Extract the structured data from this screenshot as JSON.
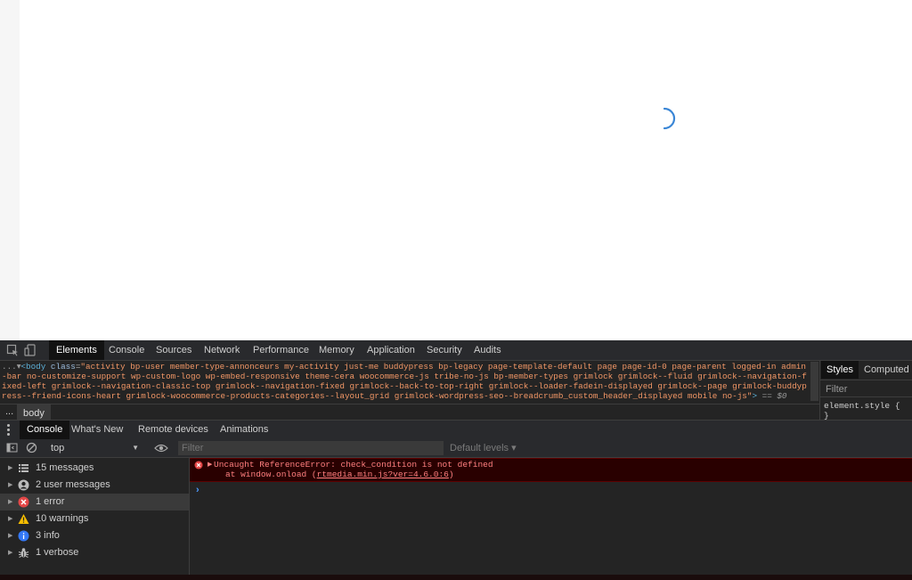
{
  "devtools": {
    "main_tabs": [
      "Elements",
      "Console",
      "Sources",
      "Network",
      "Performance",
      "Memory",
      "Application",
      "Security",
      "Audits"
    ],
    "active_main_tab": "Elements",
    "elements": {
      "ellipsis": "...",
      "tag_open": "<body",
      "attr_name": "class",
      "class_value": "\"activity bp-user member-type-annonceurs my-activity just-me buddypress bp-legacy page-template-default page page-id-0 page-parent logged-in admin-bar no-customize-support wp-custom-logo wp-embed-responsive theme-cera woocommerce-js tribe-no-js bp-member-types grimlock grimlock--fluid grimlock--navigation-fixed-left grimlock--navigation-classic-top grimlock--navigation-fixed grimlock--back-to-top-right grimlock--loader-fadein-displayed grimlock--page grimlock-buddypress--friend-icons-heart grimlock-woocommerce-products-categories--layout_grid grimlock-wordpress-seo--breadcrumb_custom_header_displayed mobile no-js\"",
      "tag_close": ">",
      "selected_marker": " == $0",
      "breadcrumb_more": "...",
      "breadcrumb_item": "body"
    },
    "styles": {
      "tabs": [
        "Styles",
        "Computed"
      ],
      "active_tab": "Styles",
      "filter_placeholder": "Filter",
      "rule_selector": "element.style {",
      "rule_close": "}"
    },
    "drawer_tabs": [
      "Console",
      "What's New",
      "Remote devices",
      "Animations"
    ],
    "active_drawer_tab": "Console",
    "console": {
      "context": "top",
      "filter_placeholder": "Filter",
      "levels": "Default levels ▾",
      "sidebar": [
        {
          "label": "15 messages",
          "icon": "list-icon"
        },
        {
          "label": "2 user messages",
          "icon": "user-icon"
        },
        {
          "label": "1 error",
          "icon": "error-icon"
        },
        {
          "label": "10 warnings",
          "icon": "warning-icon"
        },
        {
          "label": "3 info",
          "icon": "info-icon"
        },
        {
          "label": "1 verbose",
          "icon": "bug-icon"
        }
      ],
      "selected_sidebar": "1 error",
      "error": {
        "message": "Uncaught ReferenceError: check_condition is not defined",
        "stack_prefix": "at window.onload (",
        "stack_link": "rtmedia.min.js?ver=4.6.0:6",
        "stack_suffix": ")"
      },
      "prompt": "›"
    },
    "colors": {
      "background": "#242424",
      "tab_active": "#121212",
      "error_bg": "#290000",
      "error_text": "#ff8080",
      "accent_blue": "#4d9bff",
      "spinner": "#3a86d6"
    }
  }
}
